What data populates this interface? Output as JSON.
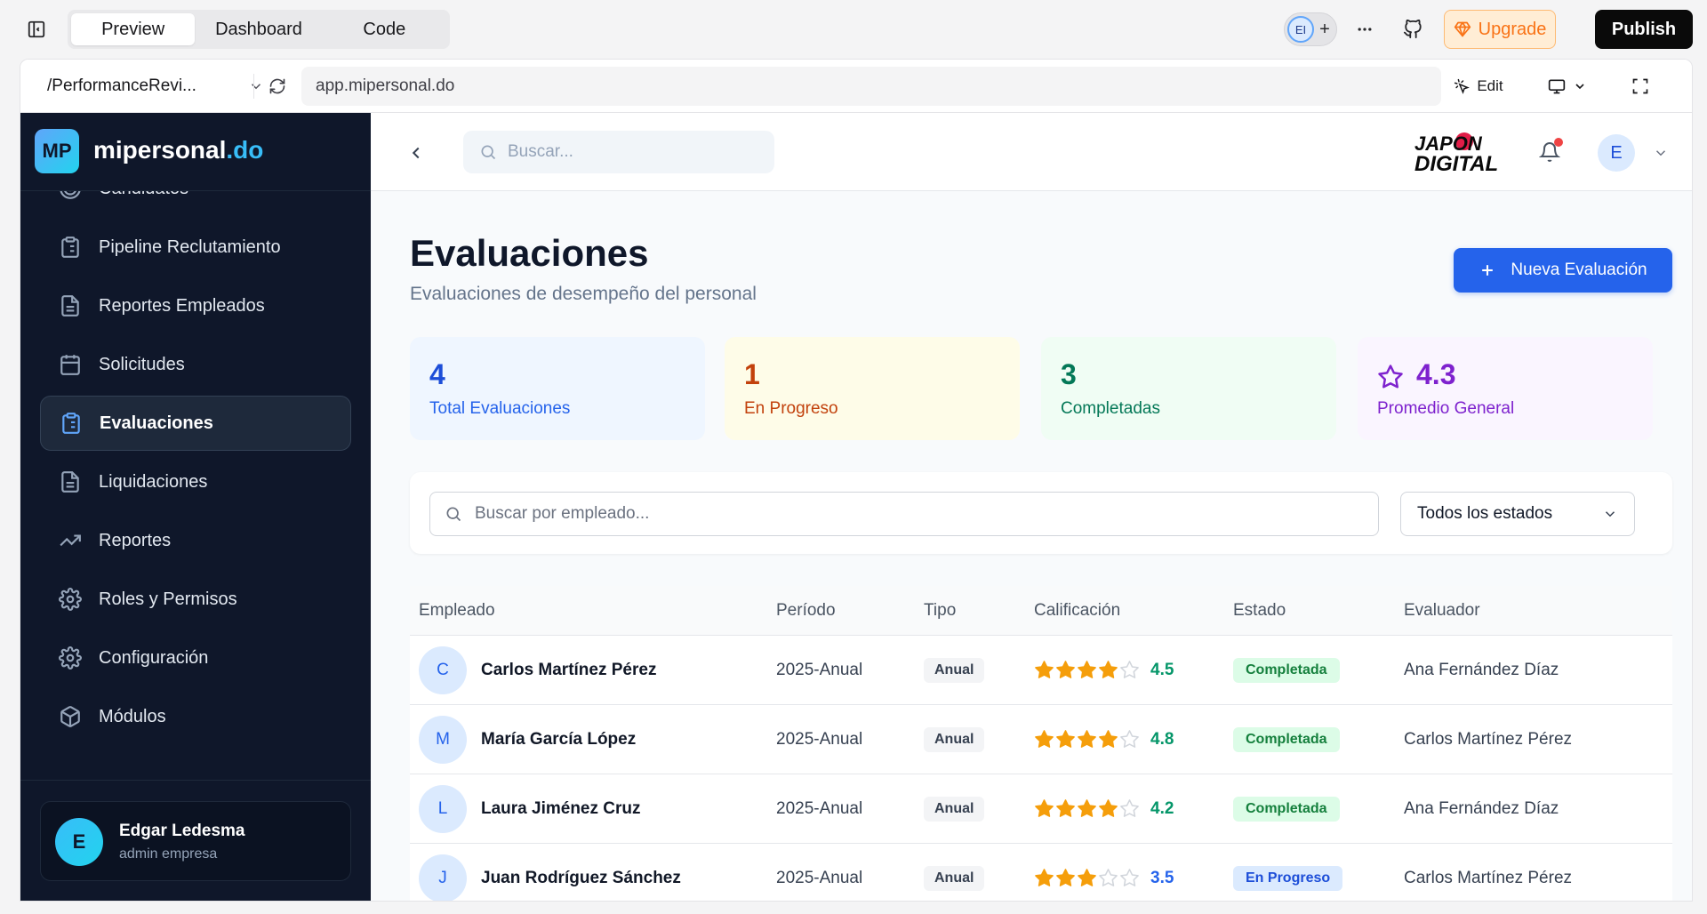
{
  "app": {
    "view_tabs": [
      "Preview",
      "Dashboard",
      "Code"
    ],
    "active_tab": "Preview",
    "collaborator_initials": "EI",
    "more_label": "···",
    "upgrade_label": "Upgrade",
    "publish_label": "Publish"
  },
  "browser": {
    "route": "/PerformanceRevi...",
    "url": "app.mipersonal.do",
    "edit_label": "Edit"
  },
  "sidebar": {
    "brand_logo": "MP",
    "brand_name": "mipersonal",
    "brand_tld": ".do",
    "items": [
      {
        "label": "Candidatos",
        "icon": "target-icon"
      },
      {
        "label": "Pipeline Reclutamiento",
        "icon": "clipboard-list-icon"
      },
      {
        "label": "Reportes Empleados",
        "icon": "file-text-icon"
      },
      {
        "label": "Solicitudes",
        "icon": "calendar-icon"
      },
      {
        "label": "Evaluaciones",
        "icon": "clipboard-list-icon",
        "active": true
      },
      {
        "label": "Liquidaciones",
        "icon": "file-text-icon"
      },
      {
        "label": "Reportes",
        "icon": "trending-up-icon"
      },
      {
        "label": "Roles y Permisos",
        "icon": "gear-icon"
      },
      {
        "label": "Configuración",
        "icon": "gear-icon"
      },
      {
        "label": "Módulos",
        "icon": "box-icon"
      }
    ],
    "user": {
      "initial": "E",
      "name": "Edgar Ledesma",
      "role": "admin empresa"
    }
  },
  "header": {
    "search_placeholder": "Buscar...",
    "logo_line1": "JAPON",
    "logo_line2": "DIGITAL",
    "avatar_initial": "E"
  },
  "page": {
    "title": "Evaluaciones",
    "subtitle": "Evaluaciones de desempeño del personal",
    "new_button": "Nueva Evaluación"
  },
  "stats": [
    {
      "value": "4",
      "label": "Total Evaluaciones"
    },
    {
      "value": "1",
      "label": "En Progreso"
    },
    {
      "value": "3",
      "label": "Completadas"
    },
    {
      "value": "4.3",
      "label": "Promedio General"
    }
  ],
  "filters": {
    "search_placeholder": "Buscar por empleado...",
    "status_select": "Todos los estados"
  },
  "table": {
    "columns": [
      "Empleado",
      "Período",
      "Tipo",
      "Calificación",
      "Estado",
      "Evaluador"
    ],
    "rows": [
      {
        "initial": "C",
        "employee": "Carlos Martínez Pérez",
        "period": "2025-Anual",
        "type": "Anual",
        "stars_filled": 4,
        "rating": "4.5",
        "status": "Completada",
        "status_kind": "done",
        "evaluator": "Ana Fernández Díaz"
      },
      {
        "initial": "M",
        "employee": "María García López",
        "period": "2025-Anual",
        "type": "Anual",
        "stars_filled": 4,
        "rating": "4.8",
        "status": "Completada",
        "status_kind": "done",
        "evaluator": "Carlos Martínez Pérez"
      },
      {
        "initial": "L",
        "employee": "Laura Jiménez Cruz",
        "period": "2025-Anual",
        "type": "Anual",
        "stars_filled": 4,
        "rating": "4.2",
        "status": "Completada",
        "status_kind": "done",
        "evaluator": "Ana Fernández Díaz"
      },
      {
        "initial": "J",
        "employee": "Juan Rodríguez Sánchez",
        "period": "2025-Anual",
        "type": "Anual",
        "stars_filled": 3,
        "rating": "3.5",
        "status": "En Progreso",
        "status_kind": "progress",
        "evaluator": "Carlos Martínez Pérez"
      }
    ]
  },
  "colors": {
    "accent": "#2563eb",
    "star_fill": "#f59e0b",
    "rating_done": "#059669",
    "rating_progress": "#2563eb"
  }
}
